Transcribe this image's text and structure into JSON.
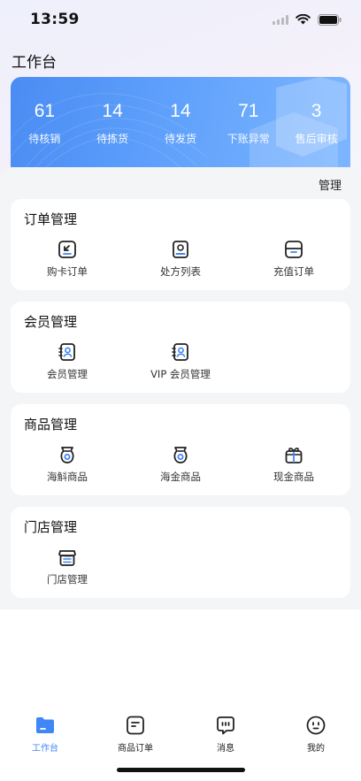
{
  "status_bar": {
    "time": "13:59"
  },
  "page": {
    "title": "工作台"
  },
  "stats": [
    {
      "value": "61",
      "label": "待核销"
    },
    {
      "value": "14",
      "label": "待拣货"
    },
    {
      "value": "14",
      "label": "待发货"
    },
    {
      "value": "71",
      "label": "下账异常"
    },
    {
      "value": "3",
      "label": "售后审核"
    }
  ],
  "manage_label": "管理",
  "sections": [
    {
      "title": "订单管理",
      "items": [
        {
          "label": "购卡订单",
          "icon": "card-order-icon"
        },
        {
          "label": "处方列表",
          "icon": "prescription-icon"
        },
        {
          "label": "充值订单",
          "icon": "recharge-icon"
        }
      ]
    },
    {
      "title": "会员管理",
      "items": [
        {
          "label": "会员管理",
          "icon": "member-icon"
        },
        {
          "label": "VIP 会员管理",
          "icon": "vip-member-icon"
        }
      ]
    },
    {
      "title": "商品管理",
      "items": [
        {
          "label": "海斛商品",
          "icon": "bag-icon"
        },
        {
          "label": "海金商品",
          "icon": "bag-icon"
        },
        {
          "label": "现金商品",
          "icon": "gift-icon"
        }
      ]
    },
    {
      "title": "门店管理",
      "items": [
        {
          "label": "门店管理",
          "icon": "store-icon"
        }
      ]
    }
  ],
  "tab_bar": [
    {
      "label": "工作台",
      "icon": "folder-icon",
      "active": true
    },
    {
      "label": "商品订单",
      "icon": "order-icon",
      "active": false
    },
    {
      "label": "消息",
      "icon": "message-icon",
      "active": false
    },
    {
      "label": "我的",
      "icon": "profile-icon",
      "active": false
    }
  ],
  "colors": {
    "accent": "#3f86f6",
    "card_gradient_start": "#4a8cf3",
    "card_gradient_end": "#7db6ff",
    "panel_bg": "#f4f5f7"
  }
}
